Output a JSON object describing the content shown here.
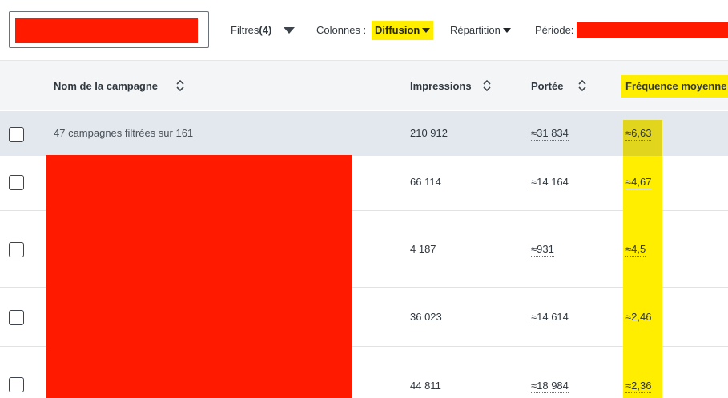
{
  "toolbar": {
    "filters_label": "Filtres",
    "filters_count": "(4)",
    "columns_label": "Colonnes :",
    "columns_value": "Diffusion",
    "breakdown_label": "Répartition",
    "period_label": "Période:"
  },
  "table": {
    "headers": {
      "name": "Nom de la campagne",
      "impressions": "Impressions",
      "reach": "Portée",
      "frequency": "Fréquence moyenne"
    },
    "summary": {
      "label": "47 campagnes filtrées sur 161",
      "impressions": "210 912",
      "reach": "≈31 834",
      "frequency": "≈6,63"
    },
    "rows": [
      {
        "impressions": "66 114",
        "reach": "≈14 164",
        "frequency": "≈4,67"
      },
      {
        "impressions": "4 187",
        "reach": "≈931",
        "frequency": "≈4,5"
      },
      {
        "impressions": "36 023",
        "reach": "≈14 614",
        "frequency": "≈2,46"
      },
      {
        "impressions": "44 811",
        "reach": "≈18 984",
        "frequency": "≈2,36"
      }
    ]
  },
  "colors": {
    "highlight": "#ffee00",
    "redaction": "#ff1a00",
    "header_bg": "#f3f5f7",
    "summary_bg": "#e3e8ee"
  },
  "icons": {
    "sort": "sort-updown-icon",
    "caret": "caret-down-icon",
    "checkbox": "checkbox-icon"
  }
}
